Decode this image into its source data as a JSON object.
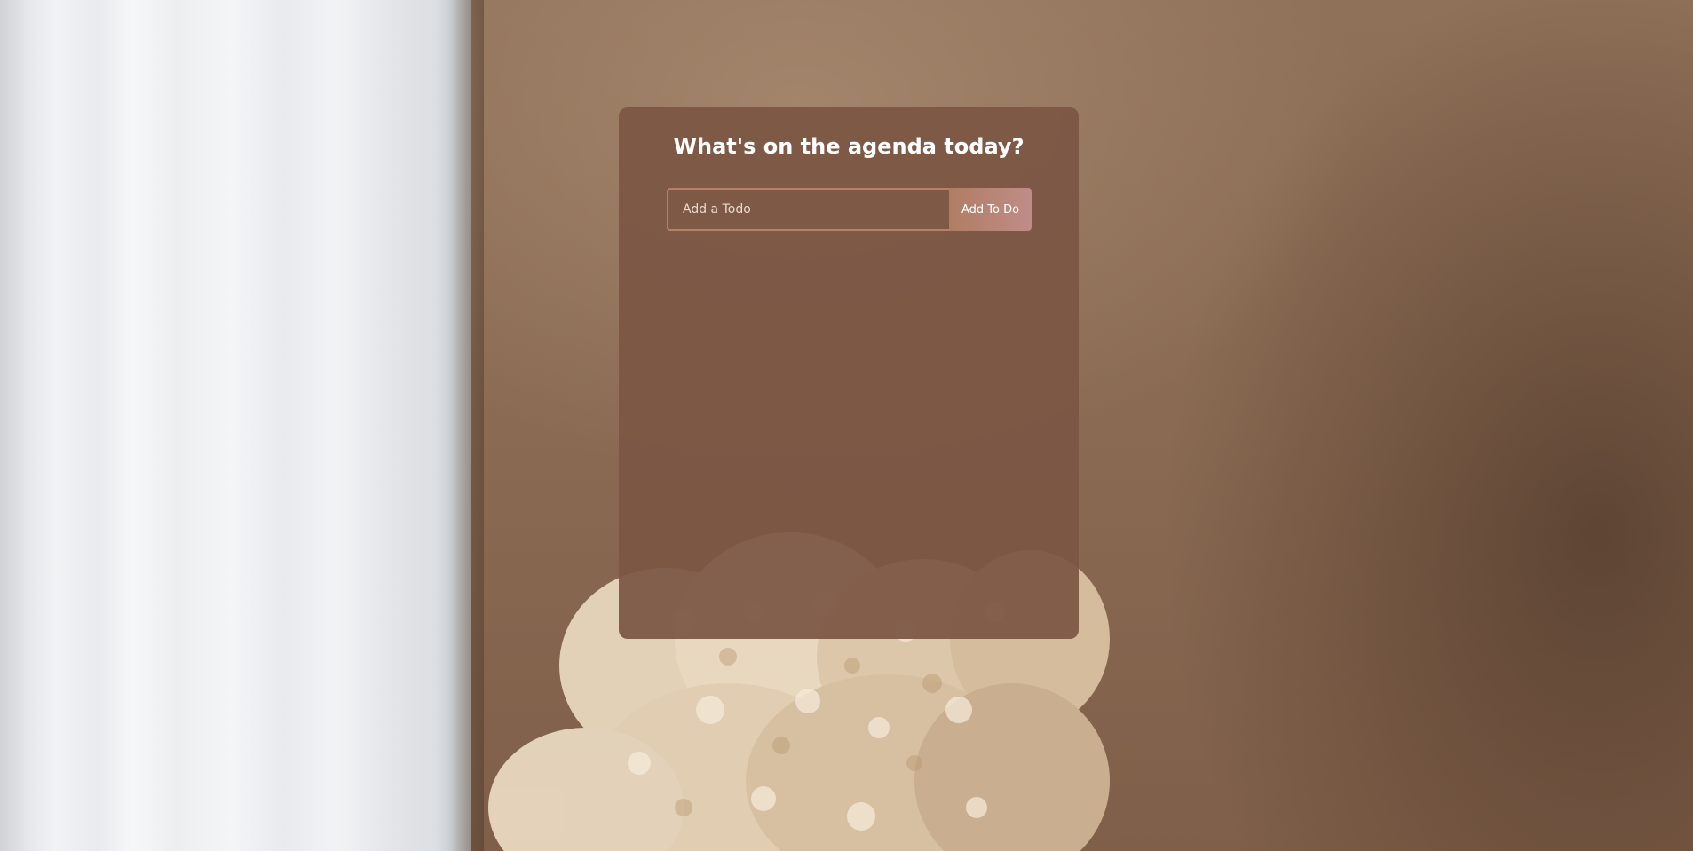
{
  "app": {
    "heading": "What's on the agenda today?"
  },
  "form": {
    "input_placeholder": "Add a Todo",
    "input_value": "",
    "submit_label": "Add To Do"
  },
  "todos": [],
  "colors": {
    "card_background": "#7b5644",
    "input_border": "#b8806a",
    "button_gradient_start": "#b07d64",
    "button_gradient_end": "#c08c88",
    "heading_text": "#ffffff"
  }
}
